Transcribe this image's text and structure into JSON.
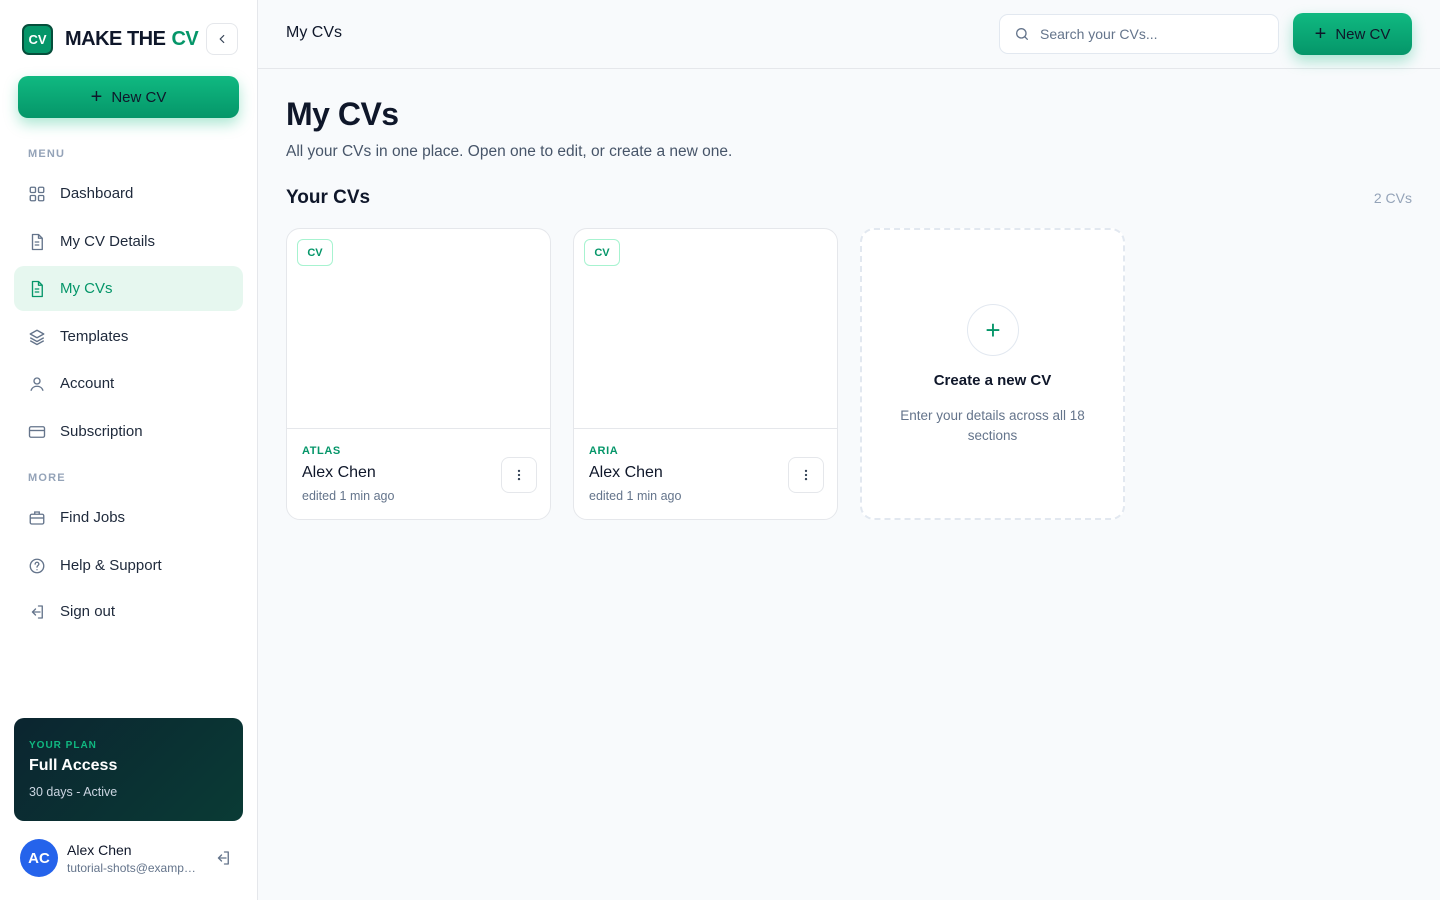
{
  "brand": {
    "logo_text": "CV",
    "name_prefix": "MAKE THE",
    "name_accent": "CV"
  },
  "sidebar": {
    "new_cv_label": "New CV",
    "menu_label": "MENU",
    "more_label": "MORE",
    "menu_items": [
      {
        "label": "Dashboard",
        "icon": "grid-icon"
      },
      {
        "label": "My CV Details",
        "icon": "document-icon"
      },
      {
        "label": "My CVs",
        "icon": "file-text-icon",
        "active": true
      },
      {
        "label": "Templates",
        "icon": "layers-icon"
      },
      {
        "label": "Account",
        "icon": "user-icon"
      },
      {
        "label": "Subscription",
        "icon": "credit-card-icon"
      }
    ],
    "more_items": [
      {
        "label": "Find Jobs",
        "icon": "briefcase-icon"
      },
      {
        "label": "Help & Support",
        "icon": "help-circle-icon"
      },
      {
        "label": "Sign out",
        "icon": "sign-out-icon"
      }
    ],
    "plan": {
      "label": "YOUR PLAN",
      "name": "Full Access",
      "status": "30 days - Active"
    },
    "user": {
      "initials": "AC",
      "name": "Alex Chen",
      "email": "tutorial-shots@example.com"
    }
  },
  "topbar": {
    "title": "My CVs",
    "search_placeholder": "Search your CVs...",
    "new_cv_label": "New CV"
  },
  "main": {
    "title": "My CVs",
    "subtitle": "All your CVs in one place. Open one to edit, or create a new one.",
    "section_heading": "Your CVs",
    "count": "2 CVs",
    "cvs": [
      {
        "badge": "CV",
        "template": "ATLAS",
        "name": "Alex Chen",
        "edited": "edited 1 min ago"
      },
      {
        "badge": "CV",
        "template": "ARIA",
        "name": "Alex Chen",
        "edited": "edited 1 min ago"
      }
    ],
    "create_card": {
      "plus": "+",
      "title": "Create a new CV",
      "description": "Enter your details across all 18 sections"
    }
  },
  "colors": {
    "accent": "#059669",
    "accent_light": "#10b981",
    "active_bg": "#e6f7ef",
    "plan_bg": "#0b2530",
    "avatar_bg": "#2563eb"
  }
}
